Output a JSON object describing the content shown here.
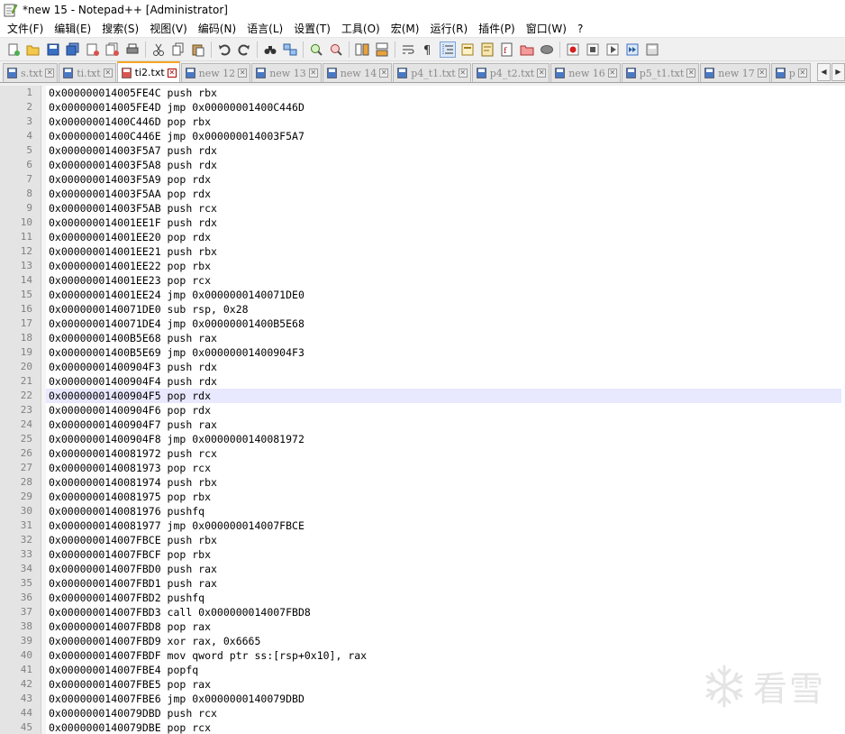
{
  "window": {
    "title": "*new 15 - Notepad++ [Administrator]"
  },
  "menu": [
    "文件(F)",
    "编辑(E)",
    "搜索(S)",
    "视图(V)",
    "编码(N)",
    "语言(L)",
    "设置(T)",
    "工具(O)",
    "宏(M)",
    "运行(R)",
    "插件(P)",
    "窗口(W)",
    "?"
  ],
  "toolbar": [
    {
      "name": "new-file",
      "icon": "new-file-icon"
    },
    {
      "name": "open-file",
      "icon": "folder-open-icon"
    },
    {
      "name": "save",
      "icon": "save-icon"
    },
    {
      "name": "save-all",
      "icon": "save-all-icon"
    },
    {
      "name": "close",
      "icon": "close-file-icon"
    },
    {
      "name": "close-all",
      "icon": "close-all-icon"
    },
    {
      "name": "print",
      "icon": "print-icon"
    },
    {
      "sep": true
    },
    {
      "name": "cut",
      "icon": "scissors-icon"
    },
    {
      "name": "copy",
      "icon": "copy-icon"
    },
    {
      "name": "paste",
      "icon": "paste-icon"
    },
    {
      "sep": true
    },
    {
      "name": "undo",
      "icon": "undo-icon"
    },
    {
      "name": "redo",
      "icon": "redo-icon"
    },
    {
      "sep": true
    },
    {
      "name": "find",
      "icon": "binoculars-icon"
    },
    {
      "name": "replace",
      "icon": "replace-icon"
    },
    {
      "sep": true
    },
    {
      "name": "zoom-in",
      "icon": "zoom-in-icon"
    },
    {
      "name": "zoom-out",
      "icon": "zoom-out-icon"
    },
    {
      "sep": true
    },
    {
      "name": "sync-v",
      "icon": "sync-vertical-icon"
    },
    {
      "name": "sync-h",
      "icon": "sync-horizontal-icon"
    },
    {
      "sep": true
    },
    {
      "name": "word-wrap",
      "icon": "word-wrap-icon"
    },
    {
      "name": "show-all-chars",
      "icon": "pilcrow-icon"
    },
    {
      "name": "indent-guide",
      "icon": "indent-guide-icon",
      "active": true
    },
    {
      "name": "udl",
      "icon": "udl-icon"
    },
    {
      "name": "doc-map",
      "icon": "doc-map-icon"
    },
    {
      "name": "function-list",
      "icon": "function-list-icon"
    },
    {
      "name": "folder-as-workspace",
      "icon": "folder-workspace-icon"
    },
    {
      "name": "monitoring",
      "icon": "eye-icon"
    },
    {
      "sep": true
    },
    {
      "name": "macro-record",
      "icon": "record-icon"
    },
    {
      "name": "macro-stop",
      "icon": "stop-icon"
    },
    {
      "name": "macro-play",
      "icon": "play-icon"
    },
    {
      "name": "macro-play-multi",
      "icon": "fast-forward-icon"
    },
    {
      "name": "macro-save",
      "icon": "macro-save-icon"
    }
  ],
  "tabs": [
    {
      "label": "s.txt",
      "active": false
    },
    {
      "label": "ti.txt",
      "active": false
    },
    {
      "label": "ti2.txt",
      "active": true
    },
    {
      "label": "new 12",
      "active": false
    },
    {
      "label": "new 13",
      "active": false
    },
    {
      "label": "new 14",
      "active": false
    },
    {
      "label": "p4_t1.txt",
      "active": false
    },
    {
      "label": "p4_t2.txt",
      "active": false
    },
    {
      "label": "new 16",
      "active": false
    },
    {
      "label": "p5_t1.txt",
      "active": false
    },
    {
      "label": "new 17",
      "active": false
    },
    {
      "label": "p",
      "active": false
    }
  ],
  "tab_close_glyph": "✕",
  "tab_scroll": {
    "left": "◀",
    "right": "▶"
  },
  "colors": {
    "current_line": "#e8e8ff",
    "active_tab_accent": "#f5a623",
    "gutter": "#e4e4e4"
  },
  "editor": {
    "current_line": 22,
    "lines": [
      "0x000000014005FE4C push rbx",
      "0x000000014005FE4D jmp 0x00000001400C446D",
      "0x00000001400C446D pop rbx",
      "0x00000001400C446E jmp 0x000000014003F5A7",
      "0x000000014003F5A7 push rdx",
      "0x000000014003F5A8 push rdx",
      "0x000000014003F5A9 pop rdx",
      "0x000000014003F5AA pop rdx",
      "0x000000014003F5AB push rcx",
      "0x000000014001EE1F push rdx",
      "0x000000014001EE20 pop rdx",
      "0x000000014001EE21 push rbx",
      "0x000000014001EE22 pop rbx",
      "0x000000014001EE23 pop rcx",
      "0x000000014001EE24 jmp 0x0000000140071DE0",
      "0x0000000140071DE0 sub rsp, 0x28",
      "0x0000000140071DE4 jmp 0x00000001400B5E68",
      "0x00000001400B5E68 push rax",
      "0x00000001400B5E69 jmp 0x00000001400904F3",
      "0x00000001400904F3 push rdx",
      "0x00000001400904F4 push rdx",
      "0x00000001400904F5 pop rdx",
      "0x00000001400904F6 pop rdx",
      "0x00000001400904F7 push rax",
      "0x00000001400904F8 jmp 0x0000000140081972",
      "0x0000000140081972 push rcx",
      "0x0000000140081973 pop rcx",
      "0x0000000140081974 push rbx",
      "0x0000000140081975 pop rbx",
      "0x0000000140081976 pushfq",
      "0x0000000140081977 jmp 0x000000014007FBCE",
      "0x000000014007FBCE push rbx",
      "0x000000014007FBCF pop rbx",
      "0x000000014007FBD0 push rax",
      "0x000000014007FBD1 push rax",
      "0x000000014007FBD2 pushfq",
      "0x000000014007FBD3 call 0x000000014007FBD8",
      "0x000000014007FBD8 pop rax",
      "0x000000014007FBD9 xor rax, 0x6665",
      "0x000000014007FBDF mov qword ptr ss:[rsp+0x10], rax",
      "0x000000014007FBE4 popfq",
      "0x000000014007FBE5 pop rax",
      "0x000000014007FBE6 jmp 0x0000000140079DBD",
      "0x0000000140079DBD push rcx",
      "0x0000000140079DBE pop rcx"
    ]
  },
  "watermark": {
    "text": "看雪",
    "icon": "snowflake-icon"
  }
}
